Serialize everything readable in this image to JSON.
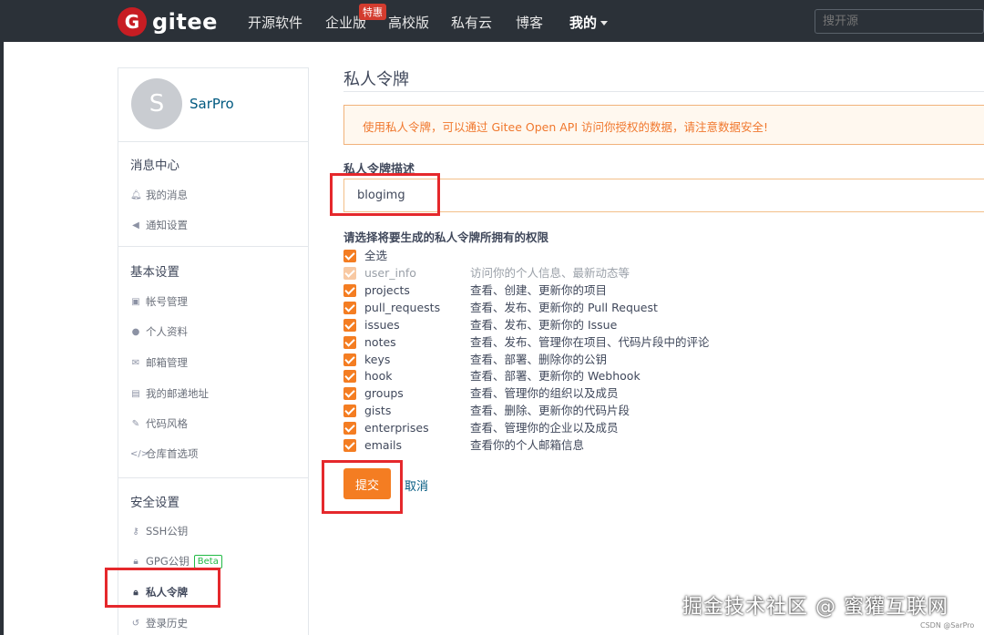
{
  "nav": {
    "logo_mark": "G",
    "logo_text": "gitee",
    "items": [
      "开源软件",
      "企业版",
      "高校版",
      "私有云",
      "博客",
      "我的"
    ],
    "badge": "特惠",
    "search_placeholder": "搜开源"
  },
  "sidebar": {
    "avatar_letter": "S",
    "username": "SarPro",
    "sections": [
      {
        "title": "消息中心",
        "items": [
          "我的消息",
          "通知设置"
        ]
      },
      {
        "title": "基本设置",
        "items": [
          "帐号管理",
          "个人资料",
          "邮箱管理",
          "我的邮递地址",
          "代码风格",
          "仓库首选项"
        ]
      },
      {
        "title": "安全设置",
        "items": [
          "SSH公钥",
          "GPG公钥",
          "私人令牌",
          "登录历史"
        ]
      }
    ],
    "beta": "Beta"
  },
  "main": {
    "title": "私人令牌",
    "notice": "使用私人令牌，可以通过 Gitee Open API 访问你授权的数据，请注意数据安全!",
    "desc_label": "私人令牌描述",
    "desc_value": "blogimg",
    "perm_label": "请选择将要生成的私人令牌所拥有的权限",
    "select_all": "全选",
    "permissions": [
      {
        "name": "user_info",
        "desc": "访问你的个人信息、最新动态等",
        "disabled": true
      },
      {
        "name": "projects",
        "desc": "查看、创建、更新你的项目"
      },
      {
        "name": "pull_requests",
        "desc": "查看、发布、更新你的 Pull Request"
      },
      {
        "name": "issues",
        "desc": "查看、发布、更新你的 Issue"
      },
      {
        "name": "notes",
        "desc": "查看、发布、管理你在项目、代码片段中的评论"
      },
      {
        "name": "keys",
        "desc": "查看、部署、删除你的公钥"
      },
      {
        "name": "hook",
        "desc": "查看、部署、更新你的 Webhook"
      },
      {
        "name": "groups",
        "desc": "查看、管理你的组织以及成员"
      },
      {
        "name": "gists",
        "desc": "查看、删除、更新你的代码片段"
      },
      {
        "name": "enterprises",
        "desc": "查看、管理你的企业以及成员"
      },
      {
        "name": "emails",
        "desc": "查看你的个人邮箱信息"
      }
    ],
    "submit": "提交",
    "cancel": "取消"
  },
  "watermark": "掘金技术社区 @ 蜜獾互联网",
  "csdn": "CSDN @SarPro",
  "colors": {
    "accent": "#f47d22",
    "nav_bg": "#2b3138",
    "highlight": "#e5282c",
    "link": "#005980"
  }
}
